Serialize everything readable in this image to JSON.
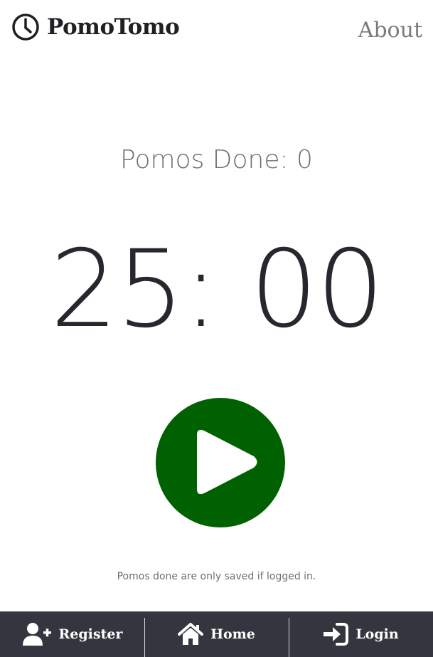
{
  "header": {
    "brand_icon": "clock-icon",
    "brand_title": "PomoTomo",
    "about_label": "About"
  },
  "main": {
    "pomos_done_label": "Pomos Done: 0",
    "timer": "25: 00",
    "play_icon": "play-icon",
    "note": "Pomos done are only saved if logged in."
  },
  "footer": {
    "items": [
      {
        "icon": "user-plus-icon",
        "label": "Register"
      },
      {
        "icon": "home-icon",
        "label": "Home"
      },
      {
        "icon": "sign-in-icon",
        "label": "Login"
      }
    ]
  },
  "colors": {
    "play_button": "#006100",
    "footer_bg": "#33363e",
    "text_dark": "#26282d",
    "text_muted": "#6c6f75"
  }
}
